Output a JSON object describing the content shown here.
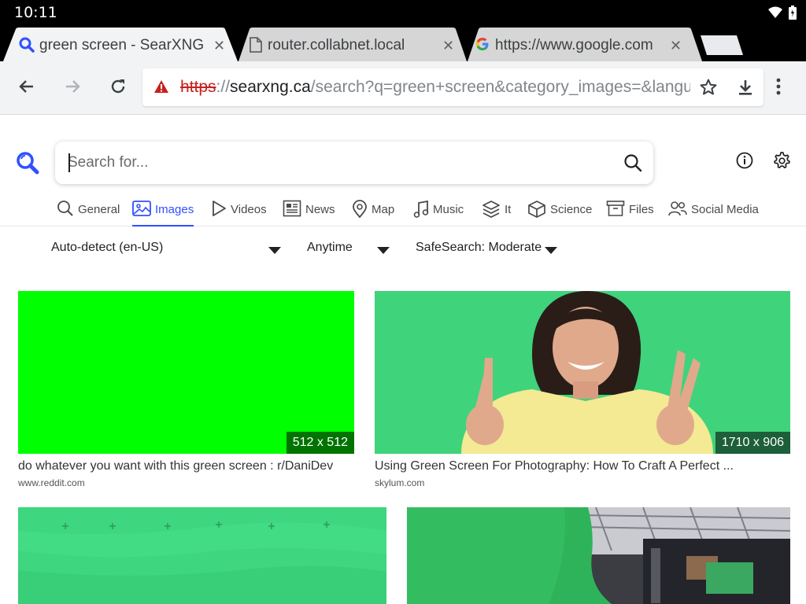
{
  "status": {
    "time": "10:11"
  },
  "tabs": [
    {
      "title": "green screen - SearXNG",
      "icon": "search-icon",
      "active": true
    },
    {
      "title": "router.collabnet.local",
      "icon": "page-icon",
      "active": false
    },
    {
      "title": "https://www.google.com",
      "icon": "google-icon",
      "active": false
    }
  ],
  "address_bar": {
    "scheme": "https",
    "separator": "://",
    "host": "searxng.ca",
    "path": "/search?q=green+screen&category_images=&language=auto"
  },
  "search": {
    "placeholder": "Search for...",
    "value": ""
  },
  "categories": [
    {
      "label": "General",
      "icon": "search-icon"
    },
    {
      "label": "Images",
      "icon": "image-icon",
      "active": true
    },
    {
      "label": "Videos",
      "icon": "play-icon"
    },
    {
      "label": "News",
      "icon": "newspaper-icon"
    },
    {
      "label": "Map",
      "icon": "map-pin-icon"
    },
    {
      "label": "Music",
      "icon": "music-icon"
    },
    {
      "label": "It",
      "icon": "layers-icon"
    },
    {
      "label": "Science",
      "icon": "cube-icon"
    },
    {
      "label": "Files",
      "icon": "archive-icon"
    },
    {
      "label": "Social Media",
      "icon": "people-icon"
    }
  ],
  "filters": {
    "language": "Auto-detect (en-US)",
    "time": "Anytime",
    "safesearch": "SafeSearch: Moderate"
  },
  "results": [
    {
      "title": "do whatever you want with this green screen : r/DaniDev",
      "domain": "www.reddit.com",
      "resolution": "512 x 512"
    },
    {
      "title": "Using Green Screen For Photography: How To Craft A Perfect ...",
      "domain": "skylum.com",
      "resolution": "1710 x 906"
    },
    {
      "title": "",
      "domain": "",
      "resolution": ""
    },
    {
      "title": "",
      "domain": "",
      "resolution": ""
    }
  ],
  "colors": {
    "accent": "#3050ff",
    "green": "#00ff00",
    "chroma": "#3cd17a"
  }
}
